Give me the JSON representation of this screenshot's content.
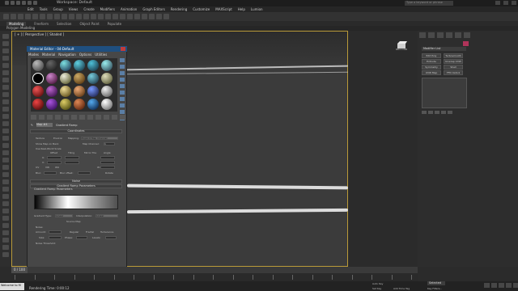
{
  "window": {
    "title": "Workspace: Default",
    "search_placeholder": "Type a keyword or phrase"
  },
  "menubar": [
    "Edit",
    "Tools",
    "Group",
    "Views",
    "Create",
    "Modifiers",
    "Animation",
    "Graph Editors",
    "Rendering",
    "Customize",
    "MAXScript",
    "Help",
    "Lumion"
  ],
  "ribbon": {
    "tabs": [
      "Modeling",
      "Freeform",
      "Selection",
      "Object Paint",
      "Populate"
    ],
    "active": "Modeling",
    "subtitle": "Polygon Modeling"
  },
  "viewport": {
    "label": "[ + ] [ Perspective ] [ Shaded ]"
  },
  "right_panel": {
    "modifier_list": "Modifier List",
    "buttons": [
      "Edit Poly",
      "Turbosmooth",
      "Extrude",
      "Unwrap UVW",
      "Symmetry",
      "Shell",
      "UVW Map",
      "FFD 4x4x4"
    ]
  },
  "material_editor": {
    "title": "Material Editor - 04-Default",
    "menu": [
      "Modes",
      "Material",
      "Navigation",
      "Options",
      "Utilities"
    ],
    "map_label": "Map #4",
    "map_type": "Gradient Ramp",
    "rollouts": {
      "coordinates": "Coordinates",
      "noise": "Noise",
      "gradient_ramp": "Gradient Ramp Parameters"
    },
    "coords": {
      "texture": "Texture",
      "environ": "Environ",
      "mapping_label": "Mapping:",
      "mapping": "Explicit Map Channel",
      "show_map": "Show Map on Back",
      "real_world": "Use Real-World Scale",
      "map_channel_label": "Map Channel:",
      "map_channel": "1",
      "offset": "Offset",
      "tiling": "Tiling",
      "mirror_tile": "Mirror Tile",
      "angle": "Angle",
      "u": "U:",
      "v": "V:",
      "w": "W:",
      "uv": "UV",
      "vw": "VW",
      "wu": "WU",
      "blur": "Blur:",
      "blur_offset": "Blur offset:",
      "rotate": "Rotate"
    },
    "grad": {
      "gradient_type_label": "Gradient Type:",
      "gradient_type": "Linear",
      "interp_label": "Interpolation:",
      "interp": "Linear",
      "source_map": "Source Map",
      "noise_label": "Noise:",
      "amount": "Amount:",
      "size": "Size:",
      "phase": "Phase:",
      "levels": "Levels:",
      "regular": "Regular",
      "fractal": "Fractal",
      "turbulence": "Turbulence",
      "noise_threshold": "Noise Threshold:",
      "gradient_key_text": "Gradient Ramp Parameters"
    }
  },
  "timeline": {
    "current": "0 / 100"
  },
  "status": {
    "maxscript": "Welcome to M",
    "render_time": "Rendering Time: 0:00:12",
    "selected": "Selected",
    "autokey": "Auto Key",
    "setkey": "Set Key",
    "add_time_tag": "Add Time Tag",
    "key_filters": "Key Filters..."
  },
  "colors": {
    "accent": "#b99a39",
    "title_blue": "#1f4f7f",
    "swatch": "#b0345a"
  }
}
